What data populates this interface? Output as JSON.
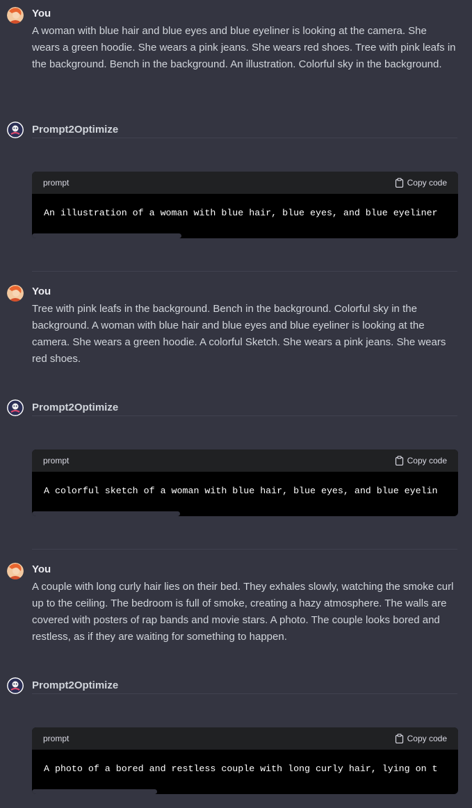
{
  "conversation": [
    {
      "user": {
        "author": "You",
        "text": "A woman with blue hair and blue eyes and blue eyeliner is looking at the camera. She wears a green hoodie. She wears a pink jeans. She wears red shoes. Tree with pink leafs in the background. Bench in the background. An illustration. Colorful sky in the background."
      },
      "bot": {
        "author": "Prompt2Optimize",
        "code_lang": "prompt",
        "copy_label": "Copy code",
        "code": "An illustration of a woman with blue hair, blue eyes, and blue eyeliner"
      }
    },
    {
      "user": {
        "author": "You",
        "text": "Tree with pink leafs in the background. Bench in the background. Colorful sky in the background. A woman with blue hair and blue eyes and blue eyeliner is looking at the camera. She wears a green hoodie. A colorful Sketch. She wears a pink jeans. She wears red shoes."
      },
      "bot": {
        "author": "Prompt2Optimize",
        "code_lang": "prompt",
        "copy_label": "Copy code",
        "code": "A colorful sketch of a woman with blue hair, blue eyes, and blue eyelin"
      }
    },
    {
      "user": {
        "author": "You",
        "text": "A couple with long curly hair lies on their bed. They exhales slowly, watching the smoke curl up to the ceiling. The bedroom is full of smoke, creating a hazy atmosphere. The walls are covered with posters of rap bands and movie stars. A photo. The couple looks bored and restless, as if they are waiting for something to happen."
      },
      "bot": {
        "author": "Prompt2Optimize",
        "code_lang": "prompt",
        "copy_label": "Copy code",
        "code": "A photo of a bored and restless couple with long curly hair, lying on t"
      }
    }
  ],
  "colors": {
    "background": "#343541",
    "code_header": "#202123",
    "code_body": "#000000",
    "user_avatar_bg": "#f3a86b",
    "bot_avatar_bg": "#2b2f55"
  }
}
